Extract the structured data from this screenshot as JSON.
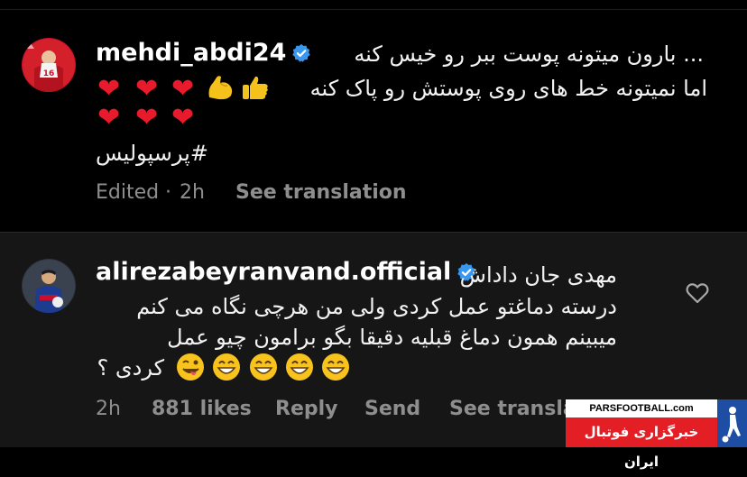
{
  "post": {
    "username": "mehdi_abdi24",
    "verified": true,
    "jersey_number": "16",
    "line1": "... بارون میتونه پوست ببر رو خیس کنه",
    "line2": "اما نمیتونه خط های روی پوستش رو پاک کنه",
    "hashtag": "#پرسپولیس",
    "edited_label": "Edited",
    "separator": "·",
    "time": "2h",
    "see_translation": "See translation",
    "emoji_icons": [
      "red-heart",
      "red-heart",
      "red-heart",
      "flexed-biceps",
      "thumbs-up",
      "red-heart",
      "red-heart",
      "red-heart"
    ]
  },
  "reply": {
    "username": "alirezabeyranvand.official",
    "verified": true,
    "line1": "مهدی جان داداش",
    "line2": "درسته دماغتو عمل کردی ولی من هرچی نگاه می کنم",
    "line3": "میبینم همون دماغ قبلیه دقیقا بگو برامون چیو عمل",
    "line4": "کردی ؟",
    "time": "2h",
    "likes": "881 likes",
    "reply_label": "Reply",
    "send_label": "Send",
    "see_translation": "See transla",
    "emoji_icons": [
      "grinning-face",
      "grinning-face",
      "grinning-face",
      "grinning-face",
      "winking-tongue-face"
    ]
  },
  "watermark": {
    "site": "PARSFOOTBALL.com",
    "tagline": "خبرگزاری فوتبال ایران"
  },
  "colors": {
    "background": "#000000",
    "reply_background": "#161616",
    "muted_text": "#8e8e8e",
    "verified_blue": "#3897f0",
    "heart_red": "#e81b2d",
    "watermark_red": "#e31e24",
    "watermark_blue": "#1d4ea3"
  }
}
